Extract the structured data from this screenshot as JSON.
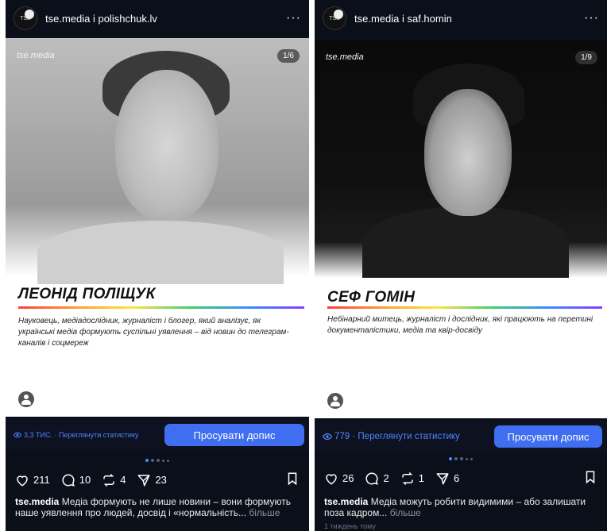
{
  "posts": [
    {
      "author": "tse.media і polishchuk.lv",
      "avatar_text": "TSE",
      "brand": "tse.media",
      "counter": "1/6",
      "name": "ЛЕОНІД ПОЛІЩУК",
      "description": "Науковець, медіадослідник, журналіст і блогер, який аналізує, як українські медіа формують суспільні уявлення – від новин до телеграм-каналів і соцмереж",
      "stats_link": "3,3 ТИС. · Переглянути статистику",
      "promote_label": "Просувати допис",
      "likes": "211",
      "comments": "10",
      "reposts": "4",
      "shares": "23",
      "caption_handle": "tse.media",
      "caption_text": "Медіа формують не лише новини – вони формують наше уявлення про людей, досвід і «нормальність...",
      "caption_more": "більше"
    },
    {
      "author": "tse.media і saf.homin",
      "avatar_text": "TSE",
      "brand": "tse.media",
      "counter": "1/9",
      "name": "СЕФ ГОМІН",
      "description": "Небінарний митець, журналіст і дослідник, які працюють на перетині документалістики, медіа та квір-досвіду",
      "stats_link": "779 · Переглянути статистику",
      "promote_label": "Просувати допис",
      "likes": "26",
      "comments": "2",
      "reposts": "1",
      "shares": "6",
      "caption_handle": "tse.media",
      "caption_text": "Медіа можуть робити видимими – або залишати поза кадром...",
      "caption_more": "більше",
      "time": "1 тиждень тому"
    }
  ],
  "colors": {
    "background": "#0b0f1a",
    "accent": "#4e87ff",
    "button": "#3f6ef0"
  }
}
